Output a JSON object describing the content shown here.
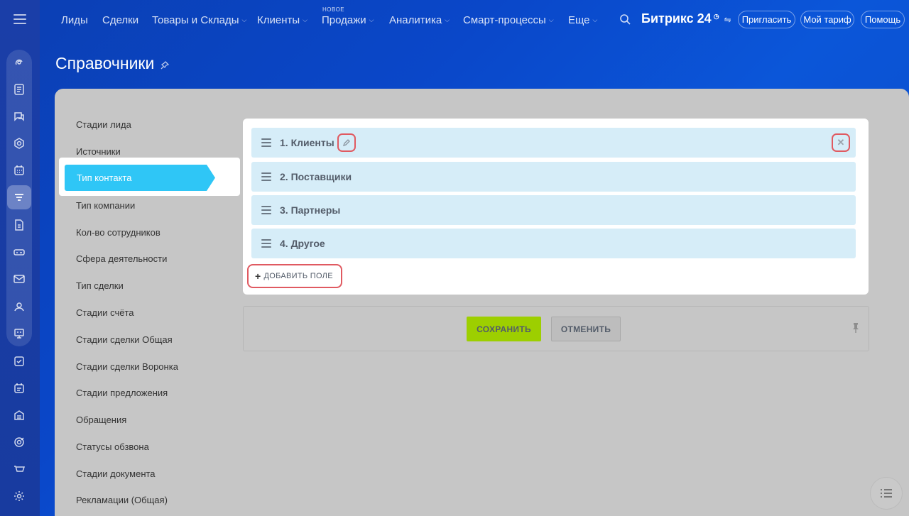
{
  "nav": {
    "items": [
      {
        "label": "Лиды",
        "dropdown": false
      },
      {
        "label": "Сделки",
        "dropdown": false
      },
      {
        "label": "Товары и Склады",
        "dropdown": true
      },
      {
        "label": "Клиенты",
        "dropdown": true
      },
      {
        "label": "Продажи",
        "dropdown": true,
        "badge": "НОВОЕ"
      },
      {
        "label": "Аналитика",
        "dropdown": true
      },
      {
        "label": "Смарт-процессы",
        "dropdown": true
      },
      {
        "label": "Еще",
        "dropdown": true
      }
    ],
    "logo": "Битрикс 24",
    "invite": "Пригласить",
    "tariff": "Мой тариф",
    "help": "Помощь"
  },
  "page": {
    "title": "Справочники"
  },
  "sidebar": {
    "items": [
      "Стадии лида",
      "Источники",
      "Тип контакта",
      "Тип компании",
      "Кол-во сотрудников",
      "Сфера деятельности",
      "Тип сделки",
      "Стадии счёта",
      "Стадии сделки Общая",
      "Стадии сделки Воронка",
      "Стадии предложения",
      "Обращения",
      "Статусы обзвона",
      "Стадии документа",
      "Рекламации (Общая)"
    ],
    "active_index": 2
  },
  "list": {
    "rows": [
      "1. Клиенты",
      "2. Поставщики",
      "3. Партнеры",
      "4. Другое"
    ],
    "add_field": "ДОБАВИТЬ ПОЛЕ"
  },
  "actions": {
    "save": "СОХРАНИТЬ",
    "cancel": "ОТМЕНИТЬ"
  },
  "colors": {
    "accent": "#2fc6f6",
    "save": "#9dcf00",
    "row_bg": "#d6edf8",
    "highlight": "#e05a61"
  }
}
